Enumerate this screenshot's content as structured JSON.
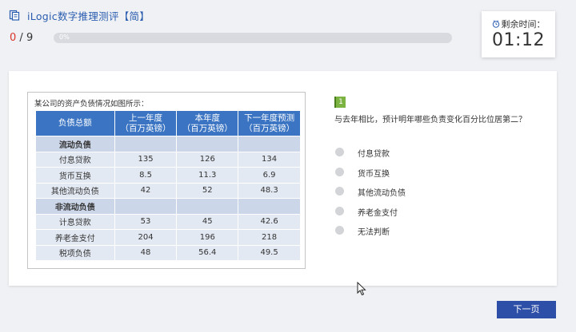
{
  "header": {
    "title": "iLogic数字推理测评【简】",
    "progress_current": "0",
    "progress_total": "9",
    "progress_percent": "0%",
    "progress_fraction": 0
  },
  "timer": {
    "label": "剩余时间：",
    "value": "01:12"
  },
  "table": {
    "caption": "某公司的资产负债情况如图所示：",
    "headers": [
      [
        "负债总额"
      ],
      [
        "上一年度",
        "（百万英镑）"
      ],
      [
        "本年度",
        "（百万英镑）"
      ],
      [
        "下一年度预测",
        "（百万英镑）"
      ]
    ],
    "rows": [
      {
        "label": "流动负债",
        "section": true,
        "values": [
          "",
          "",
          ""
        ]
      },
      {
        "label": "付息贷款",
        "section": false,
        "values": [
          "135",
          "126",
          "134"
        ]
      },
      {
        "label": "货币互换",
        "section": false,
        "values": [
          "8.5",
          "11.3",
          "6.9"
        ]
      },
      {
        "label": "其他流动负债",
        "section": false,
        "values": [
          "42",
          "52",
          "48.3"
        ]
      },
      {
        "label": "非流动负债",
        "section": true,
        "values": [
          "",
          "",
          ""
        ]
      },
      {
        "label": "计息贷款",
        "section": false,
        "values": [
          "53",
          "45",
          "42.6"
        ]
      },
      {
        "label": "养老金支付",
        "section": false,
        "values": [
          "204",
          "196",
          "218"
        ]
      },
      {
        "label": "税项负债",
        "section": false,
        "values": [
          "48",
          "56.4",
          "49.5"
        ]
      }
    ]
  },
  "question": {
    "number": "1",
    "text": "与去年相比，预计明年哪些负责变化百分比位居第二？",
    "options": [
      "付息贷款",
      "货币互换",
      "其他流动负债",
      "养老金支付",
      "无法判断"
    ]
  },
  "footer": {
    "next_label": "下一页"
  },
  "colors": {
    "accent": "#2a5db0",
    "table_header": "#3a74c2",
    "badge": "#7cb342",
    "next_button": "#2d4fa7"
  },
  "icons": {
    "app": "document-icon",
    "timer": "clock-icon",
    "cursor": "mouse-pointer-icon"
  }
}
